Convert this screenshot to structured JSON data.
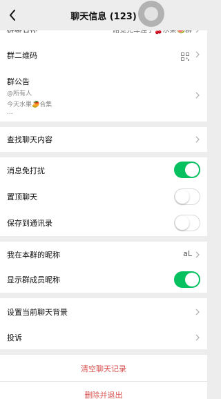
{
  "header": {
    "title": "聊天信息 (123)"
  },
  "rows": {
    "group_name_label": "群聊名称",
    "group_name_value": "路览兜车连子🍒水果🍉群",
    "qrcode_label": "群二维码",
    "notice_label": "群公告",
    "notice_line1": "@所有人",
    "notice_line2": "今天水果🥭合集",
    "notice_line3": "...",
    "search_label": "查找聊天内容",
    "mute_label": "消息免打扰",
    "pin_label": "置顶聊天",
    "save_contacts_label": "保存到通讯录",
    "nickname_label": "我在本群的昵称",
    "nickname_value": "aL",
    "show_member_names_label": "显示群成员昵称",
    "background_label": "设置当前聊天背景",
    "report_label": "投诉"
  },
  "toggles": {
    "mute": true,
    "pin": false,
    "save_contacts": false,
    "show_member_names": true
  },
  "actions": {
    "clear_history": "清空聊天记录",
    "delete_exit": "删除并退出"
  },
  "colors": {
    "accent_green": "#07c160",
    "danger_red": "#d9534f",
    "background": "#ededed"
  }
}
